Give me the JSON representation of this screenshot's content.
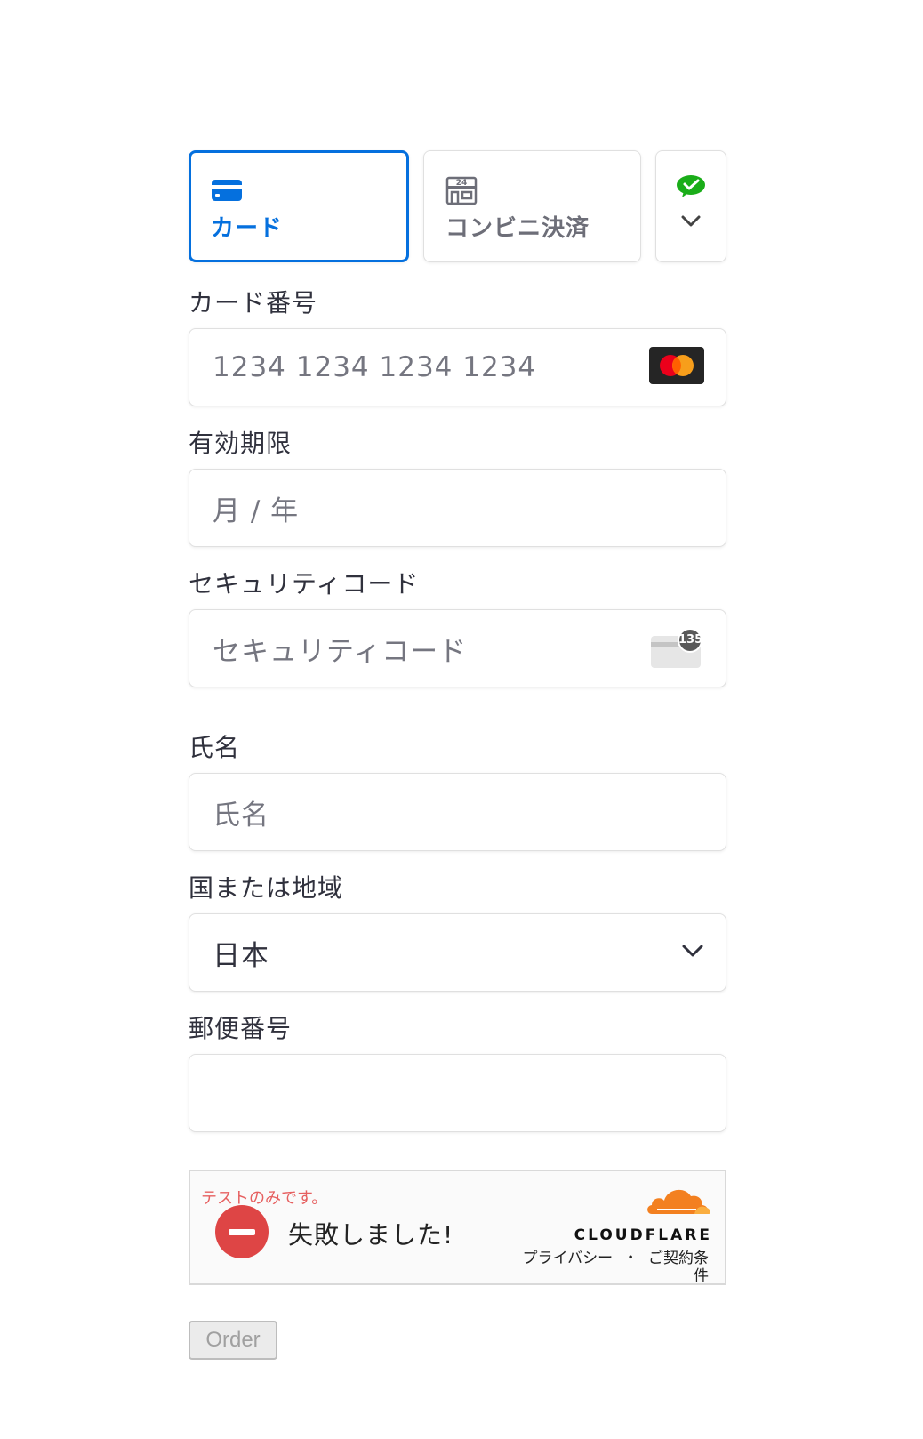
{
  "tabs": [
    {
      "label": "カード",
      "icon": "credit-card-icon",
      "active": true
    },
    {
      "label": "コンビニ決済",
      "icon": "convenience-store-24-icon",
      "active": false
    },
    {
      "label": "",
      "icon": "wechat-pay-icon",
      "secondary_icon": "chevron-down-icon"
    }
  ],
  "card_number": {
    "label": "カード番号",
    "placeholder": "1234 1234 1234 1234",
    "brand_icon": "mastercard-icon"
  },
  "expiry": {
    "label": "有効期限",
    "placeholder": "月 / 年"
  },
  "cvc": {
    "label": "セキュリティコード",
    "placeholder": "セキュリティコード",
    "icon_badge": "135"
  },
  "name": {
    "label": "氏名",
    "placeholder": "氏名"
  },
  "country": {
    "label": "国または地域",
    "value": "日本"
  },
  "postal": {
    "label": "郵便番号",
    "value": ""
  },
  "turnstile": {
    "test_notice": "テストのみです。",
    "status": "失敗しました!",
    "brand": "CLOUDFLARE",
    "privacy": "プライバシー",
    "separator": "・",
    "terms": "ご契約条件"
  },
  "order_button": "Order",
  "colors": {
    "accent": "#0570de",
    "error": "#de4545",
    "cloudflare": "#f38020"
  }
}
